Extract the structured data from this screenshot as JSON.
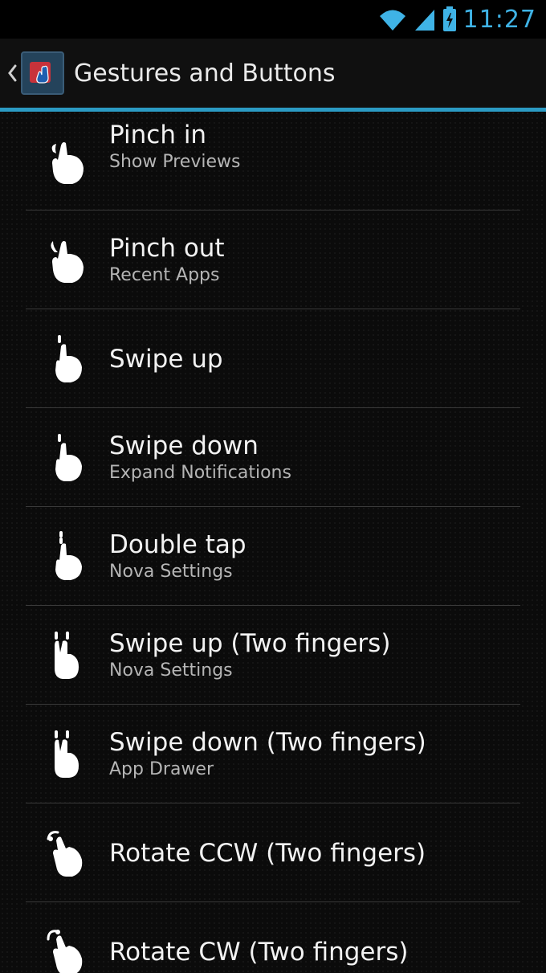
{
  "status_bar": {
    "time": "11:27",
    "icons": [
      "wifi-icon",
      "signal-icon",
      "battery-icon"
    ],
    "accent": "#3fb3e6"
  },
  "action_bar": {
    "title": "Gestures and Buttons",
    "back_icon": "chevron-left-icon",
    "app_icon": "nova-launcher-icon",
    "divider_color": "#2b9bc4"
  },
  "gestures": [
    {
      "title": "Pinch in",
      "summary": "Show Previews",
      "icon": "pinch-in-icon"
    },
    {
      "title": "Pinch out",
      "summary": "Recent Apps",
      "icon": "pinch-out-icon"
    },
    {
      "title": "Swipe up",
      "summary": "",
      "icon": "swipe-up-icon"
    },
    {
      "title": "Swipe down",
      "summary": "Expand Notifications",
      "icon": "swipe-down-icon"
    },
    {
      "title": "Double tap",
      "summary": "Nova Settings",
      "icon": "double-tap-icon"
    },
    {
      "title": "Swipe up (Two fingers)",
      "summary": "Nova Settings",
      "icon": "two-finger-swipe-up-icon"
    },
    {
      "title": "Swipe down (Two fingers)",
      "summary": "App Drawer",
      "icon": "two-finger-swipe-down-icon"
    },
    {
      "title": "Rotate CCW (Two fingers)",
      "summary": "",
      "icon": "rotate-ccw-icon"
    },
    {
      "title": "Rotate CW (Two fingers)",
      "summary": "",
      "icon": "rotate-cw-icon"
    }
  ]
}
